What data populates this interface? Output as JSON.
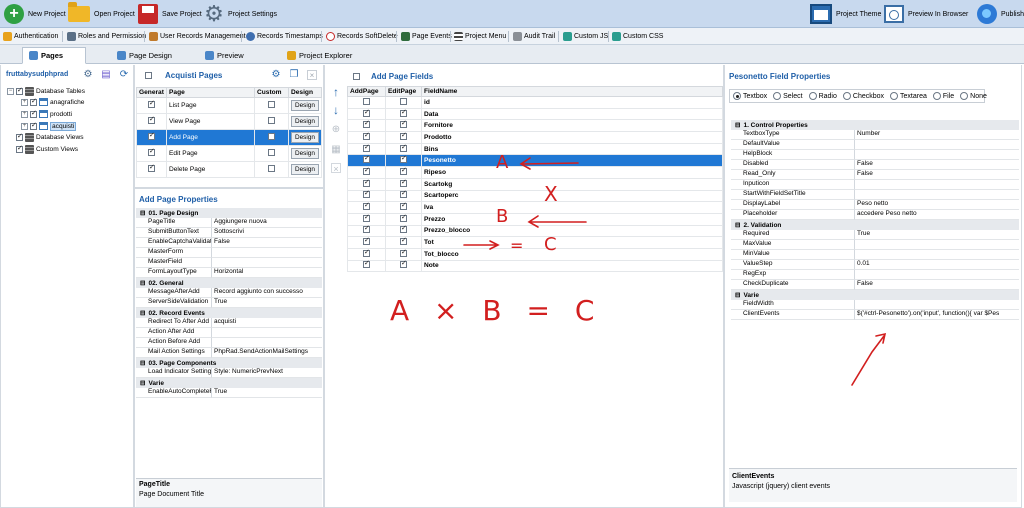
{
  "ribbon": {
    "new_project": "New Project",
    "open_project": "Open Project",
    "save_project": "Save Project",
    "project_settings": "Project Settings",
    "project_theme": "Project Theme",
    "preview_in_browser": "Preview In Browser",
    "publish": "Publish"
  },
  "toolbar": {
    "authentication": "Authentication",
    "roles_permission": "Roles and Permission",
    "user_records": "User Records Management",
    "records_timestamps": "Records Timestamps",
    "records_softdelete": "Records SoftDelete",
    "page_events": "Page Events",
    "project_menu": "Project Menu",
    "audit_trail": "Audit Trail",
    "custom_js": "Custom JS",
    "custom_css": "Custom CSS"
  },
  "tabs": {
    "pages": "Pages",
    "page_design": "Page Design",
    "preview": "Preview",
    "project_explorer": "Project Explorer"
  },
  "tree": {
    "project": "fruttabysudphprad",
    "database_tables": "Database Tables",
    "anagrafiche": "anagrafiche",
    "prodotti": "prodotti",
    "acquisti": "acquisti",
    "database_views": "Database Views",
    "custom_views": "Custom Views"
  },
  "pages_panel": {
    "title": "Acquisti Pages",
    "headers": [
      "Generat",
      "Page",
      "Custom",
      "Design"
    ],
    "design_label": "Design",
    "rows": [
      {
        "page": "List Page",
        "generate": true
      },
      {
        "page": "View Page",
        "generate": true
      },
      {
        "page": "Add Page",
        "generate": true
      },
      {
        "page": "Edit Page",
        "generate": true
      },
      {
        "page": "Delete Page",
        "generate": true
      }
    ]
  },
  "add_page_props": {
    "title": "Add Page Properties",
    "categories": {
      "c1": "01. Page Design",
      "c2": "02. General",
      "c3": "02. Record Events",
      "c4": "03. Page Components",
      "c5": "Varie"
    },
    "rows": {
      "r1": {
        "k": "PageTitle",
        "v": "Aggiungere nuova"
      },
      "r2": {
        "k": "SubmitButtonText",
        "v": "Sottoscrivi"
      },
      "r3": {
        "k": "EnableCaptchaValidation",
        "v": "False"
      },
      "r4": {
        "k": "MasterForm",
        "v": ""
      },
      "r5": {
        "k": "MasterField",
        "v": ""
      },
      "r6": {
        "k": "FormLayoutType",
        "v": "Horizontal"
      },
      "r7": {
        "k": "MessageAfterAdd",
        "v": "Record aggiunto con successo"
      },
      "r8": {
        "k": "ServerSideValidation",
        "v": "True"
      },
      "r9": {
        "k": "Redirect To After Add",
        "v": "acquisti"
      },
      "r10": {
        "k": "Action After Add",
        "v": ""
      },
      "r11": {
        "k": "Action Before Add",
        "v": ""
      },
      "r12": {
        "k": "Mail Action Settings",
        "v": "PhpRad.SendActionMailSettings"
      },
      "r13": {
        "k": "Load Indicator Settings",
        "v": "Style: NumericPrevNext"
      },
      "r14": {
        "k": "EnableAutoCompleteField",
        "v": "True"
      }
    },
    "desc_title": "PageTitle",
    "desc_text": "Page Document Title"
  },
  "fields_panel": {
    "title": "Add Page Fields",
    "headers": [
      "AddPage",
      "EditPage",
      "FieldName"
    ],
    "rows": [
      {
        "name": "id",
        "add": false,
        "edit": false
      },
      {
        "name": "Data",
        "add": true,
        "edit": true
      },
      {
        "name": "Fornitore",
        "add": true,
        "edit": true
      },
      {
        "name": "Prodotto",
        "add": true,
        "edit": true
      },
      {
        "name": "Bins",
        "add": true,
        "edit": true
      },
      {
        "name": "Pesonetto",
        "add": true,
        "edit": true
      },
      {
        "name": "Ripeso",
        "add": true,
        "edit": true
      },
      {
        "name": "Scartokg",
        "add": true,
        "edit": true
      },
      {
        "name": "Scartoperc",
        "add": true,
        "edit": true
      },
      {
        "name": "Iva",
        "add": true,
        "edit": true
      },
      {
        "name": "Prezzo",
        "add": true,
        "edit": true
      },
      {
        "name": "Prezzo_blocco",
        "add": true,
        "edit": true
      },
      {
        "name": "Tot",
        "add": true,
        "edit": true
      },
      {
        "name": "Tot_blocco",
        "add": true,
        "edit": true
      },
      {
        "name": "Note",
        "add": true,
        "edit": true
      }
    ]
  },
  "field_props": {
    "title": "Pesonetto Field Properties",
    "types": [
      "Textbox",
      "Select",
      "Radio",
      "Checkbox",
      "Textarea",
      "File",
      "None"
    ],
    "selected_type": "Textbox",
    "categories": {
      "c1": "1. Control Properties",
      "c2": "2. Validation",
      "c3": "Varie"
    },
    "rows": {
      "p1": {
        "k": "TextboxType",
        "v": "Number"
      },
      "p2": {
        "k": "DefaultValue",
        "v": ""
      },
      "p3": {
        "k": "HelpBlock",
        "v": ""
      },
      "p4": {
        "k": "Disabled",
        "v": "False"
      },
      "p5": {
        "k": "Read_Only",
        "v": "False"
      },
      "p6": {
        "k": "Inputicon",
        "v": ""
      },
      "p7": {
        "k": "StartWithFieldSetTitle",
        "v": ""
      },
      "p8": {
        "k": "DisplayLabel",
        "v": "Peso netto"
      },
      "p9": {
        "k": "Placeholder",
        "v": "accedere  Peso netto"
      },
      "p10": {
        "k": "Required",
        "v": "True"
      },
      "p11": {
        "k": "MaxValue",
        "v": ""
      },
      "p12": {
        "k": "MinValue",
        "v": ""
      },
      "p13": {
        "k": "ValueStep",
        "v": "0.01"
      },
      "p14": {
        "k": "RegExp",
        "v": ""
      },
      "p15": {
        "k": "CheckDuplicate",
        "v": "False"
      },
      "p16": {
        "k": "FieldWidth",
        "v": ""
      },
      "p17": {
        "k": "ClientEvents",
        "v": "$('#ctrl-Pesonetto').on('input', function(){  var $Pes"
      }
    },
    "desc_title": "ClientEvents",
    "desc_text": "Javascript (jquery) client events"
  },
  "annotations": {
    "a": "A",
    "x": "X",
    "b": "B",
    "eq": "=",
    "c": "C",
    "formula": "A × B = C"
  },
  "colors": {
    "selection": "#2078d4",
    "annotation": "#d21f1f",
    "ribbon": "#c8d9ee",
    "title_blue": "#1f5fa8"
  }
}
